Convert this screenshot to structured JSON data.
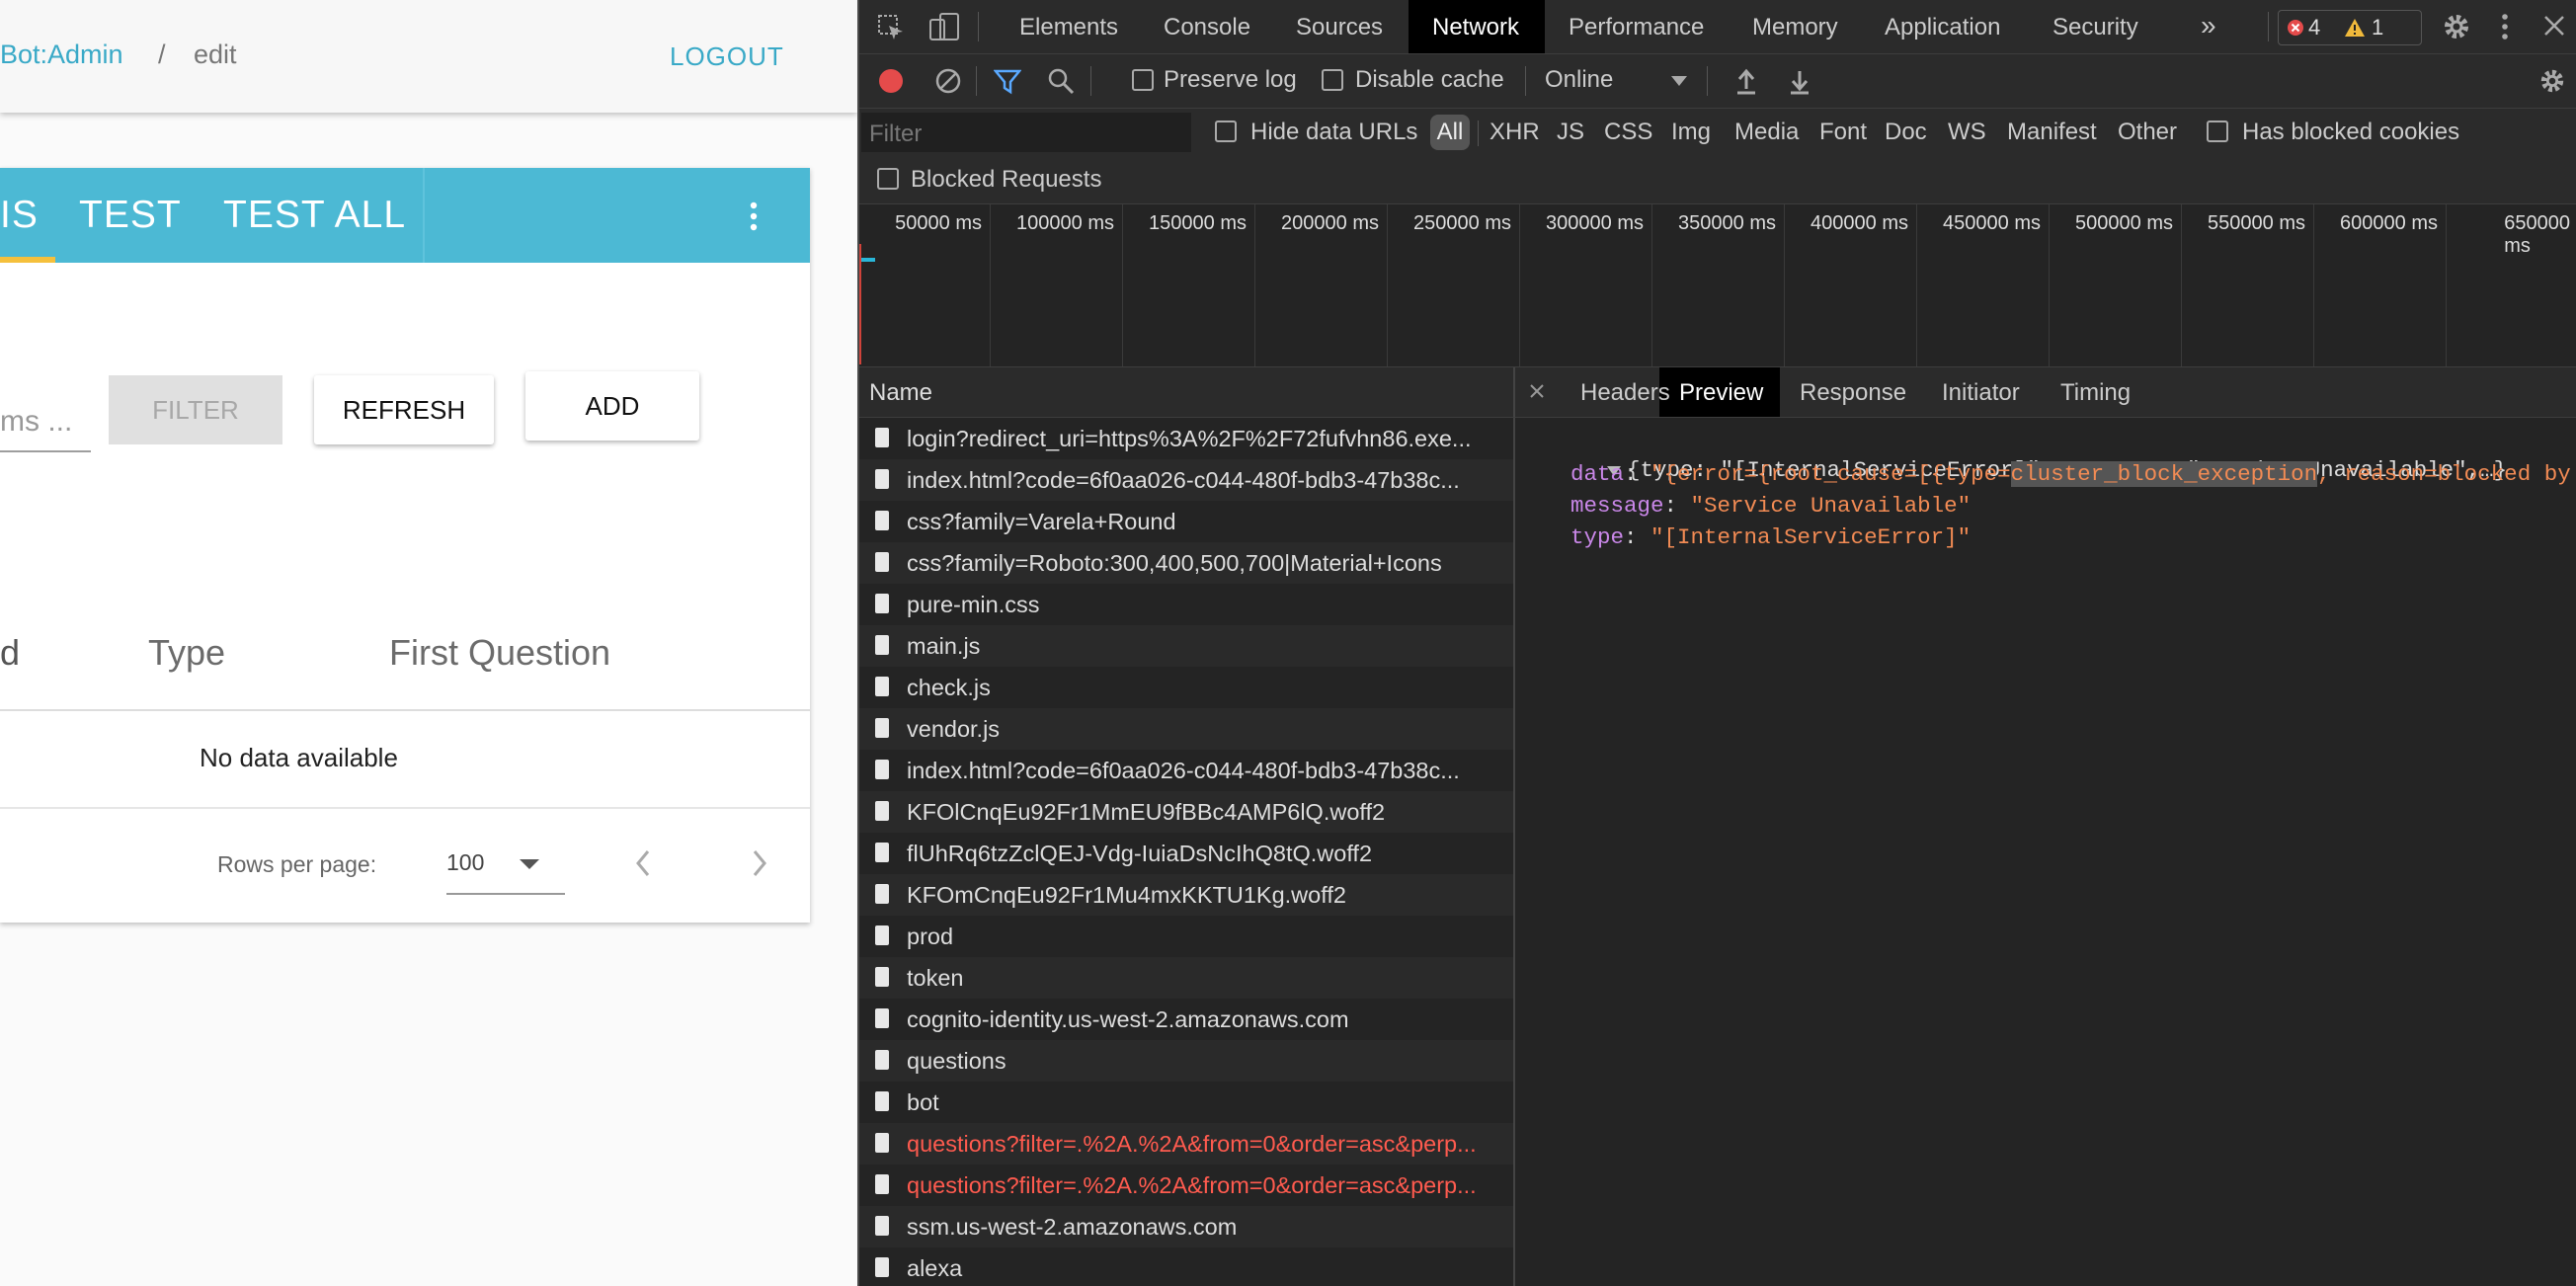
{
  "app": {
    "breadcrumb": {
      "bot": "Bot:Admin",
      "sep": "/",
      "current": "edit"
    },
    "logout_label": "LOGOUT",
    "tabs": [
      {
        "label": "IS"
      },
      {
        "label": "TEST"
      },
      {
        "label": "TEST ALL"
      }
    ],
    "search_placeholder": "ms ...",
    "buttons": {
      "filter": "FILTER",
      "refresh": "REFRESH",
      "add": "ADD"
    },
    "table": {
      "columns": [
        "d",
        "Type",
        "First Question"
      ],
      "empty_text": "No data available"
    },
    "pagination": {
      "rows_per_page_label": "Rows per page:",
      "rows_per_page_value": "100"
    }
  },
  "devtools": {
    "tabs": [
      "Elements",
      "Console",
      "Sources",
      "Network",
      "Performance",
      "Memory",
      "Application",
      "Security"
    ],
    "active_tab": "Network",
    "more_tabs": "»",
    "error_count": "4",
    "warning_count": "1",
    "toolbar": {
      "preserve_log": "Preserve log",
      "disable_cache": "Disable cache",
      "throttle": "Online"
    },
    "filter": {
      "placeholder": "Filter",
      "hide_data_urls": "Hide data URLs",
      "types": [
        "All",
        "XHR",
        "JS",
        "CSS",
        "Img",
        "Media",
        "Font",
        "Doc",
        "WS",
        "Manifest",
        "Other"
      ],
      "has_blocked_cookies": "Has blocked cookies",
      "blocked_requests": "Blocked Requests"
    },
    "timeline_ticks": [
      "50000 ms",
      "100000 ms",
      "150000 ms",
      "200000 ms",
      "250000 ms",
      "300000 ms",
      "350000 ms",
      "400000 ms",
      "450000 ms",
      "500000 ms",
      "550000 ms",
      "600000 ms",
      "650000 ms"
    ],
    "name_header": "Name",
    "requests": [
      {
        "name": "login?redirect_uri=https%3A%2F%2F72fufvhn86.exe...",
        "error": false
      },
      {
        "name": "index.html?code=6f0aa026-c044-480f-bdb3-47b38c...",
        "error": false
      },
      {
        "name": "css?family=Varela+Round",
        "error": false
      },
      {
        "name": "css?family=Roboto:300,400,500,700|Material+Icons",
        "error": false
      },
      {
        "name": "pure-min.css",
        "error": false
      },
      {
        "name": "main.js",
        "error": false
      },
      {
        "name": "check.js",
        "error": false
      },
      {
        "name": "vendor.js",
        "error": false
      },
      {
        "name": "index.html?code=6f0aa026-c044-480f-bdb3-47b38c...",
        "error": false
      },
      {
        "name": "KFOlCnqEu92Fr1MmEU9fBBc4AMP6lQ.woff2",
        "error": false
      },
      {
        "name": "flUhRq6tzZclQEJ-Vdg-IuiaDsNcIhQ8tQ.woff2",
        "error": false
      },
      {
        "name": "KFOmCnqEu92Fr1Mu4mxKKTU1Kg.woff2",
        "error": false
      },
      {
        "name": "prod",
        "error": false
      },
      {
        "name": "token",
        "error": false
      },
      {
        "name": "cognito-identity.us-west-2.amazonaws.com",
        "error": false
      },
      {
        "name": "questions",
        "error": false
      },
      {
        "name": "bot",
        "error": false
      },
      {
        "name": "questions?filter=.%2A.%2A&from=0&order=asc&perp...",
        "error": true
      },
      {
        "name": "questions?filter=.%2A.%2A&from=0&order=asc&perp...",
        "error": true
      },
      {
        "name": "ssm.us-west-2.amazonaws.com",
        "error": false
      },
      {
        "name": "alexa",
        "error": false
      }
    ],
    "detail_tabs": [
      "Headers",
      "Preview",
      "Response",
      "Initiator",
      "Timing"
    ],
    "detail_active": "Preview",
    "preview": {
      "summary": "{type: \"[InternalServiceError]\", message: \"Service Unavailable\",…}",
      "data_key": "data",
      "data_prefix": "\"{error={root_cause=[{type=",
      "data_highlight": "cluster_block_exception",
      "data_suffix": ", reason=blocked by:",
      "message_key": "message",
      "message_val": "\"Service Unavailable\"",
      "type_key": "type",
      "type_val": "\"[InternalServiceError]\""
    },
    "colors": {
      "error_text": "#ff5b4f",
      "key": "#c987e8",
      "string": "#f28b54",
      "accent": "#4cb9d4"
    }
  }
}
